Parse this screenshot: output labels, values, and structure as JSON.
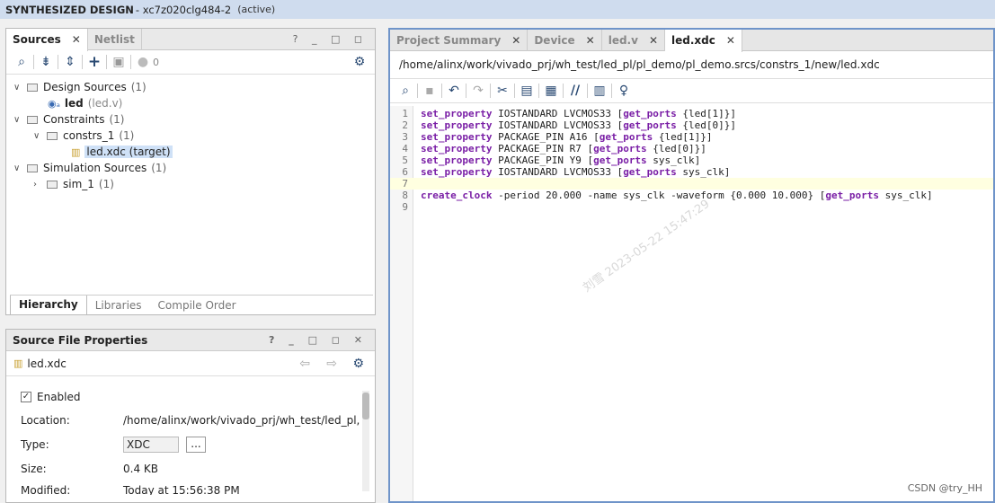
{
  "title_bar": {
    "title": "SYNTHESIZED DESIGN",
    "part": "- xc7z020clg484-2",
    "state": "(active)"
  },
  "sources": {
    "tabs": [
      {
        "label": "Sources"
      },
      {
        "label": "Netlist"
      }
    ],
    "window_controls": "? _ □ ◻",
    "toolbar_count": "0",
    "tree": {
      "design_sources": {
        "label": "Design Sources",
        "count": "(1)"
      },
      "led": {
        "label": "led",
        "file": "(led.v)"
      },
      "constraints": {
        "label": "Constraints",
        "count": "(1)"
      },
      "constrs_1": {
        "label": "constrs_1",
        "count": "(1)"
      },
      "led_xdc": {
        "label": "led.xdc (target)"
      },
      "simulation_sources": {
        "label": "Simulation Sources",
        "count": "(1)"
      },
      "sim_1": {
        "label": "sim_1",
        "count": "(1)"
      }
    },
    "bottom_tabs": [
      {
        "label": "Hierarchy"
      },
      {
        "label": "Libraries"
      },
      {
        "label": "Compile Order"
      }
    ]
  },
  "properties": {
    "title": "Source File Properties",
    "window_controls": "? _ □ ◻ ✕",
    "file": "led.xdc",
    "enabled": "Enabled",
    "location_label": "Location:",
    "location_value": "/home/alinx/work/vivado_prj/wh_test/led_pl,",
    "type_label": "Type:",
    "type_value": "XDC",
    "type_btn": "...",
    "size_label": "Size:",
    "size_value": "0.4 KB",
    "modified_label": "Modified:",
    "modified_value": "Today at 15:56:38 PM"
  },
  "editor": {
    "tabs": [
      {
        "label": "Project Summary"
      },
      {
        "label": "Device"
      },
      {
        "label": "led.v"
      },
      {
        "label": "led.xdc"
      }
    ],
    "path": "/home/alinx/work/vivado_prj/wh_test/led_pl/pl_demo/pl_demo.srcs/constrs_1/new/led.xdc",
    "lines": [
      {
        "n": "1",
        "kw": "set_property",
        "rest1": " IOSTANDARD LVCMOS33 [",
        "kw2": "get_ports",
        "rest2": " {led[1]}]"
      },
      {
        "n": "2",
        "kw": "set_property",
        "rest1": " IOSTANDARD LVCMOS33 [",
        "kw2": "get_ports",
        "rest2": " {led[0]}]"
      },
      {
        "n": "3",
        "kw": "set_property",
        "rest1": " PACKAGE_PIN A16 [",
        "kw2": "get_ports",
        "rest2": " {led[1]}]"
      },
      {
        "n": "4",
        "kw": "set_property",
        "rest1": " PACKAGE_PIN R7 [",
        "kw2": "get_ports",
        "rest2": " {led[0]}]"
      },
      {
        "n": "5",
        "kw": "set_property",
        "rest1": " PACKAGE_PIN Y9 [",
        "kw2": "get_ports",
        "rest2": " sys_clk]"
      },
      {
        "n": "6",
        "kw": "set_property",
        "rest1": " IOSTANDARD LVCMOS33 [",
        "kw2": "get_ports",
        "rest2": " sys_clk]"
      },
      {
        "n": "7",
        "kw": "",
        "rest1": "",
        "kw2": "",
        "rest2": ""
      },
      {
        "n": "8",
        "kw": "create_clock",
        "rest1": " -period 20.000 -name sys_clk -waveform {0.000 10.000} [",
        "kw2": "get_ports",
        "rest2": " sys_clk]"
      },
      {
        "n": "9",
        "kw": "",
        "rest1": "",
        "kw2": "",
        "rest2": ""
      }
    ],
    "watermark": "刘雪 2023-05-22 15:47:29"
  },
  "footer": {
    "credit": "CSDN @try_HH"
  },
  "colors": {
    "accent": "#3f6fb5",
    "keyword": "#7a1fa6"
  }
}
